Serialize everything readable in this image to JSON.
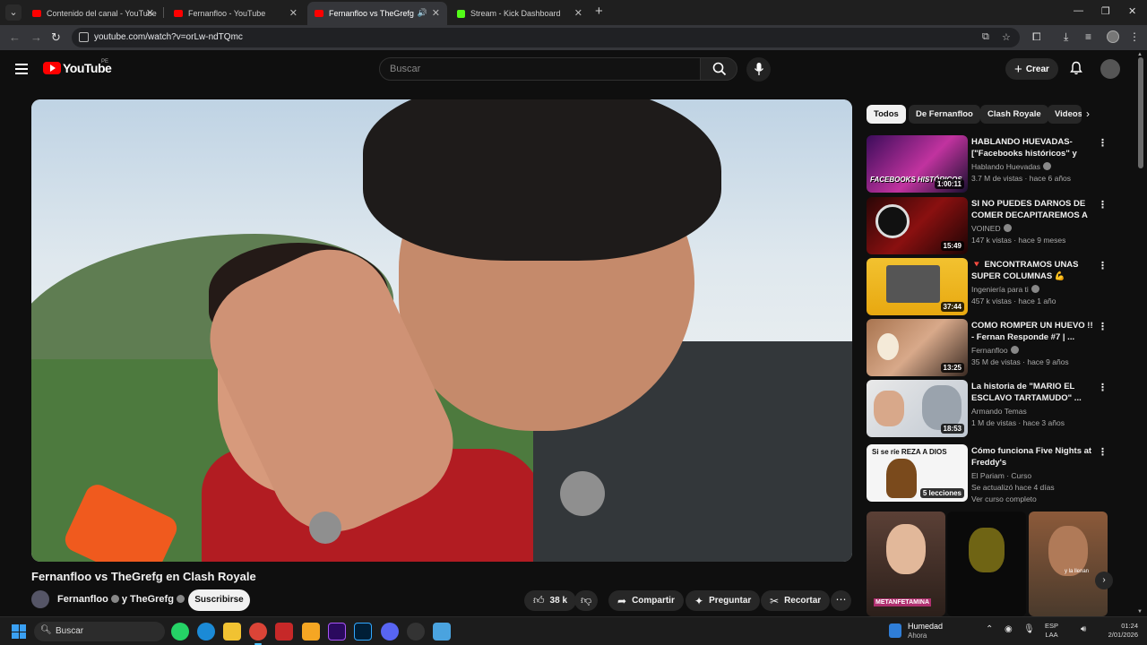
{
  "browser": {
    "tabs": [
      {
        "title": "Contenido del canal - YouTube",
        "favicon": "youtube-icon"
      },
      {
        "title": "Fernanfloo - YouTube",
        "favicon": "youtube-icon"
      },
      {
        "title": "Fernanfloo vs TheGrefg en",
        "favicon": "youtube-icon",
        "active": true,
        "audio": true
      },
      {
        "title": "Stream - Kick Dashboard",
        "favicon": "kick-icon"
      }
    ],
    "url": "youtube.com/watch?v=orLw-ndTQmc"
  },
  "masthead": {
    "logo_text": "YouTube",
    "country_code": "PE",
    "search_placeholder": "Buscar",
    "create_label": "Crear"
  },
  "video": {
    "title": "Fernanfloo vs TheGrefg en Clash Royale",
    "channel_line": "Fernanfloo",
    "channel_line2": "y TheGrefg",
    "subscribe_label": "Suscribirse",
    "likes": "38 k",
    "share_label": "Compartir",
    "ask_label": "Preguntar",
    "clip_label": "Recortar"
  },
  "chips": [
    "Todos",
    "De Fernanfloo",
    "Clash Royale",
    "Videos"
  ],
  "recommendations": [
    {
      "title": "HABLANDO HUEVADAS- [\"Facebooks históricos\" y \"Jor...",
      "channel": "Hablando Huevadas",
      "meta": "3.7 M de vistas · hace 6 años",
      "duration": "1:00:11",
      "thumb_text": "FACEBOOKS HISTÓRICOS"
    },
    {
      "title": "SI NO PUEDES DARNOS DE COMER DECAPITAREMOS A T...",
      "channel": "VOINED",
      "meta": "147 k vistas · hace 9 meses",
      "duration": "15:49"
    },
    {
      "title": "🔻 ENCONTRAMOS UNAS SUPER COLUMNAS 💪 ¿SERÁ...",
      "channel": "Ingeniería para ti",
      "meta": "457 k vistas · hace 1 año",
      "duration": "37:44"
    },
    {
      "title": "COMO ROMPER UN HUEVO !! - Fernan Responde #7 | ...",
      "channel": "Fernanfloo",
      "meta": "35 M de vistas · hace 9 años",
      "duration": "13:25"
    },
    {
      "title": "La historia de \"MARIO EL ESCLAVO TARTAMUDO\" ...",
      "channel": "Armando Temas",
      "meta": "1 M de vistas · hace 3 años",
      "duration": "18:53"
    },
    {
      "title": "Cómo funciona Five Nights at Freddy's",
      "channel": "El Pariam · Curso",
      "meta": "Se actualizó hace 4 días",
      "meta2": "Ver curso completo",
      "duration": "5 lecciones",
      "thumb_text": "Si se ríe REZA A DIOS"
    }
  ],
  "shorts": [
    {
      "caption": "METANFETAMINA"
    },
    {
      "caption": ""
    },
    {
      "caption": "y la llenan"
    }
  ],
  "taskbar": {
    "search_label": "Buscar",
    "weather_title": "Humedad",
    "weather_sub": "Ahora",
    "lang_top": "ESP",
    "lang_bottom": "LAA",
    "time": "01:24",
    "date": "2/01/2026"
  }
}
